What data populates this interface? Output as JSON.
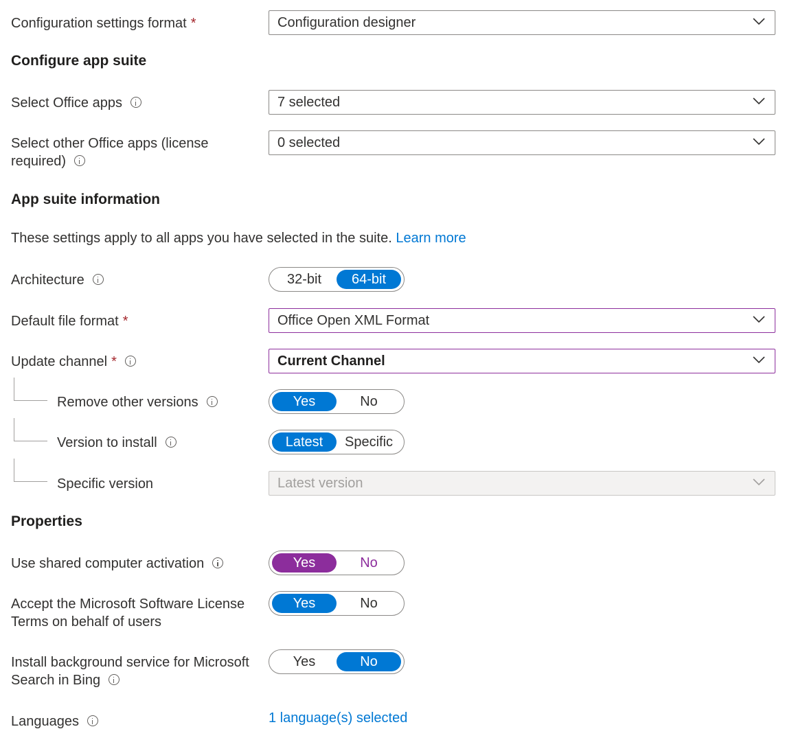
{
  "config_format": {
    "label": "Configuration settings format",
    "required": "*",
    "value": "Configuration designer"
  },
  "sections": {
    "configure_app_suite": "Configure app suite",
    "app_suite_information": "App suite information",
    "properties": "Properties"
  },
  "select_office_apps": {
    "label": "Select Office apps",
    "value": "7 selected"
  },
  "select_other_apps": {
    "label_line1": "Select other Office apps (license",
    "label_line2": "required)",
    "value": "0 selected"
  },
  "description": {
    "text": "These settings apply to all apps you have selected in the suite.",
    "link": "Learn more"
  },
  "architecture": {
    "label": "Architecture",
    "options": [
      "32-bit",
      "64-bit"
    ],
    "selected": "64-bit"
  },
  "default_file_format": {
    "label": "Default file format",
    "required": "*",
    "value": "Office Open XML Format"
  },
  "update_channel": {
    "label": "Update channel",
    "required": "*",
    "value": "Current Channel"
  },
  "remove_other_versions": {
    "label": "Remove other versions",
    "options": [
      "Yes",
      "No"
    ],
    "selected": "Yes"
  },
  "version_to_install": {
    "label": "Version to install",
    "options": [
      "Latest",
      "Specific"
    ],
    "selected": "Latest"
  },
  "specific_version": {
    "label": "Specific version",
    "placeholder": "Latest version"
  },
  "shared_computer_activation": {
    "label": "Use shared computer activation",
    "options": [
      "Yes",
      "No"
    ],
    "selected": "Yes"
  },
  "accept_license": {
    "label_line1": "Accept the Microsoft Software License",
    "label_line2": "Terms on behalf of users",
    "options": [
      "Yes",
      "No"
    ],
    "selected": "Yes"
  },
  "background_service": {
    "label_line1": "Install background service for Microsoft",
    "label_line2": "Search in Bing",
    "options": [
      "Yes",
      "No"
    ],
    "selected": "No"
  },
  "languages": {
    "label": "Languages",
    "value": "1 language(s) selected"
  },
  "colors": {
    "accent": "#0078d4",
    "focus": "#8c2d9c",
    "required": "#a4262c"
  }
}
